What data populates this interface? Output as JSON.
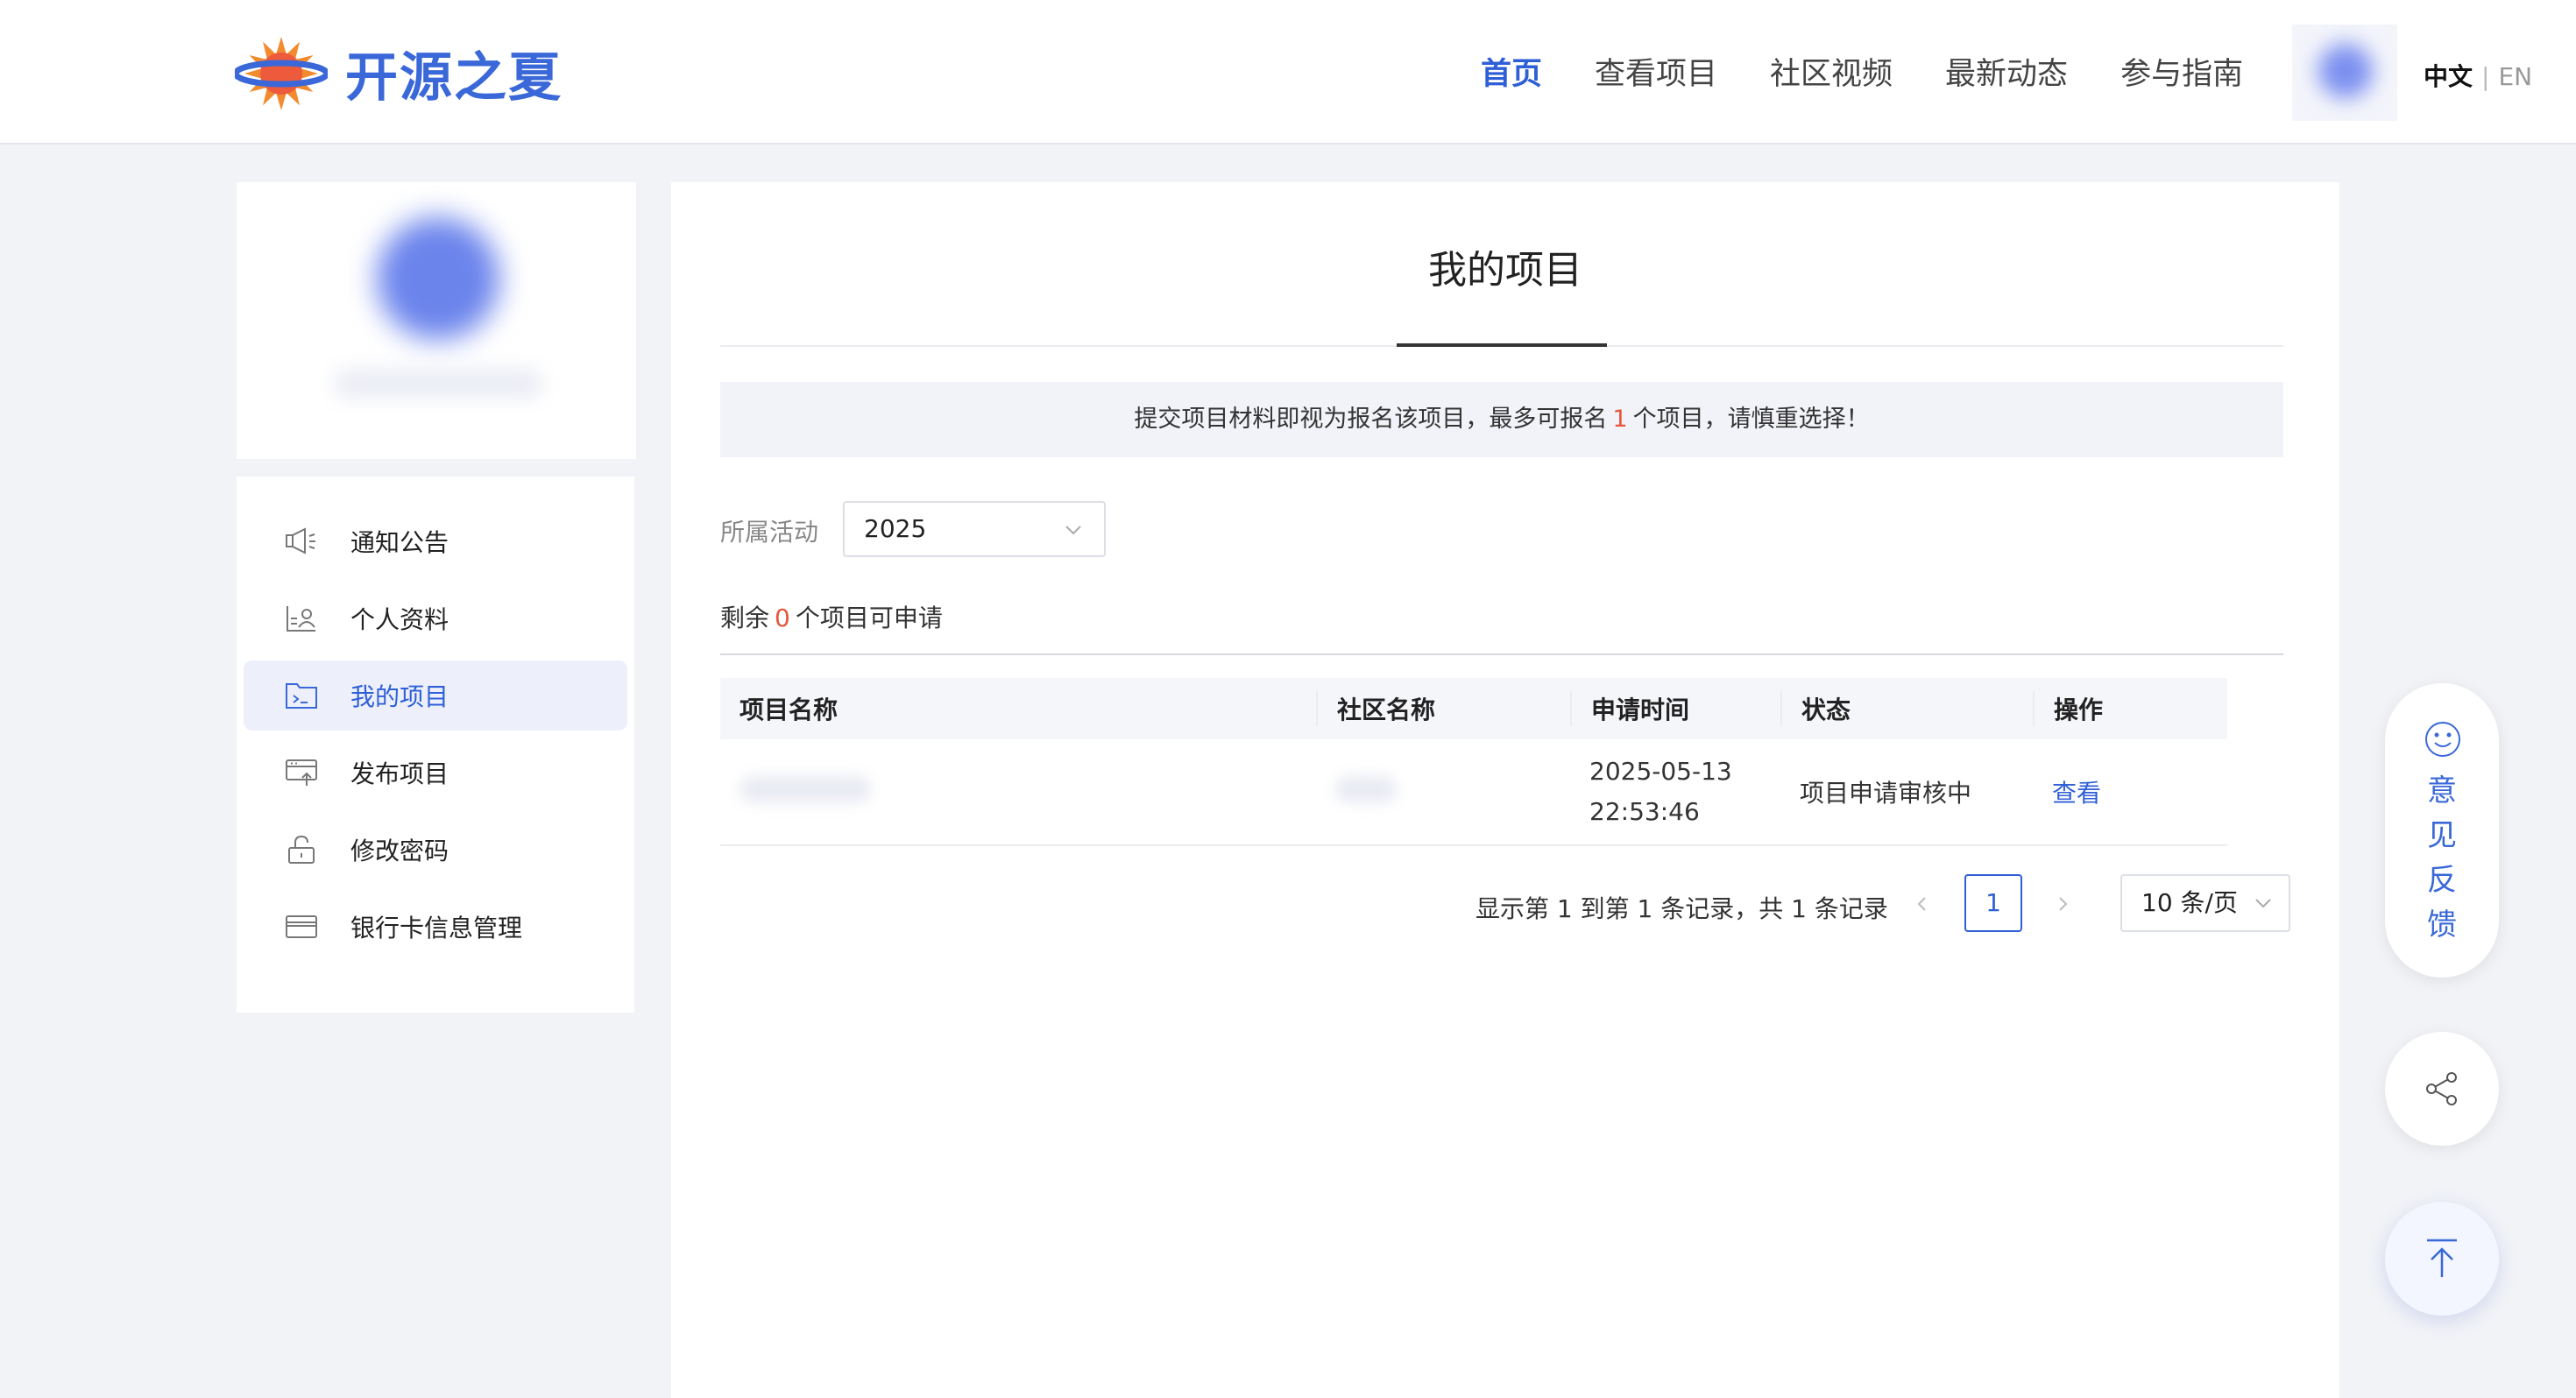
{
  "header": {
    "logo_text": "开源之夏",
    "nav": [
      {
        "label": "首页",
        "active": true
      },
      {
        "label": "查看项目",
        "active": false
      },
      {
        "label": "社区视频",
        "active": false
      },
      {
        "label": "最新动态",
        "active": false
      },
      {
        "label": "参与指南",
        "active": false
      }
    ],
    "lang_zh": "中文",
    "lang_sep": "|",
    "lang_en": "EN"
  },
  "sidebar": {
    "items": [
      {
        "label": "通知公告",
        "icon": "megaphone-icon",
        "active": false
      },
      {
        "label": "个人资料",
        "icon": "profile-card-icon",
        "active": false
      },
      {
        "label": "我的项目",
        "icon": "folder-terminal-icon",
        "active": true
      },
      {
        "label": "发布项目",
        "icon": "publish-icon",
        "active": false
      },
      {
        "label": "修改密码",
        "icon": "lock-icon",
        "active": false
      },
      {
        "label": "银行卡信息管理",
        "icon": "bank-card-icon",
        "active": false
      }
    ]
  },
  "main": {
    "title": "我的项目",
    "notice_before": "提交项目材料即视为报名该项目，最多可报名",
    "notice_count": "1",
    "notice_after": "个项目，请慎重选择！",
    "filter_label": "所属活动",
    "filter_value": "2025",
    "remain_before": "剩余",
    "remain_count": "0",
    "remain_after": "个项目可申请",
    "table": {
      "headers": [
        "项目名称",
        "社区名称",
        "申请时间",
        "状态",
        "操作"
      ],
      "rows": [
        {
          "date": "2025-05-13",
          "time": "22:53:46",
          "status": "项目申请审核中",
          "action": "查看"
        }
      ]
    },
    "pagination": {
      "info": "显示第 1 到第 1 条记录，共 1 条记录",
      "current_page": "1",
      "page_size": "10 条/页"
    }
  },
  "floating": {
    "feedback_chars": [
      "意",
      "见",
      "反",
      "馈"
    ]
  },
  "colors": {
    "accent": "#2f5fd6",
    "highlight_red": "#e4573d"
  }
}
